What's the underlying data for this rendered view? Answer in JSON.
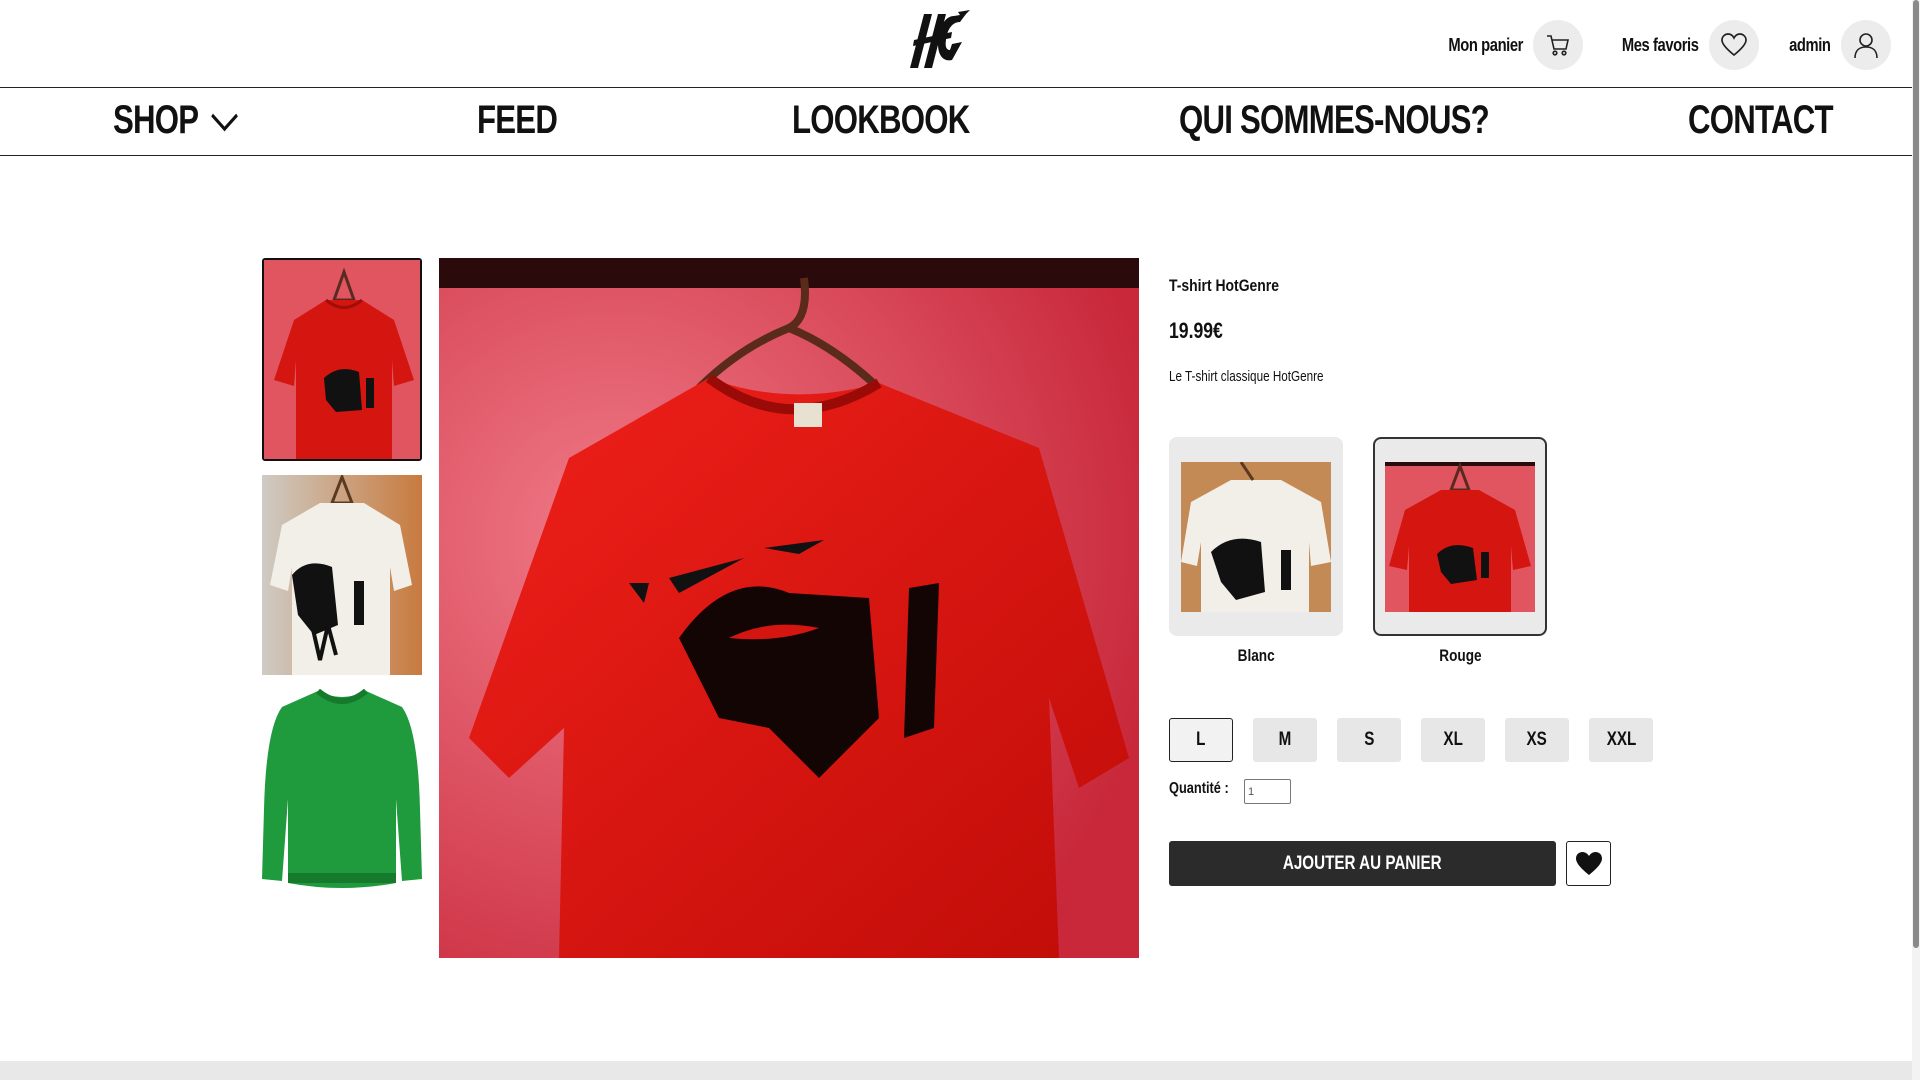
{
  "header": {
    "cart_label": "Mon panier",
    "favorites_label": "Mes favoris",
    "user_label": "admin",
    "icons": [
      "logo",
      "cart-icon",
      "heart-icon",
      "user-icon"
    ]
  },
  "nav": {
    "items": [
      {
        "label": "SHOP",
        "icon": "chevron-down-icon"
      },
      {
        "label": "FEED"
      },
      {
        "label": "LOOKBOOK"
      },
      {
        "label": "QUI SOMMES-NOUS?"
      },
      {
        "label": "CONTACT"
      }
    ]
  },
  "gallery": {
    "thumbnails": [
      "red-tshirt",
      "white-tshirt",
      "green-sweater"
    ],
    "selected_index": 0
  },
  "product": {
    "name": "T-shirt HotGenre",
    "price": "19.99€",
    "description": "Le T-shirt classique HotGenre",
    "colors": [
      {
        "label": "Blanc"
      },
      {
        "label": "Rouge",
        "selected": true
      }
    ],
    "sizes": [
      "L",
      "M",
      "S",
      "XL",
      "XS",
      "XXL"
    ],
    "selected_size": "L",
    "quantity_label": "Quantité :",
    "quantity_value": "1",
    "add_to_cart_label": "AJOUTER AU PANIER"
  },
  "colors": {
    "accent_dark": "#2b2b2b",
    "shirt_red": "#e01a12",
    "sweater_green": "#1f9a3c"
  }
}
